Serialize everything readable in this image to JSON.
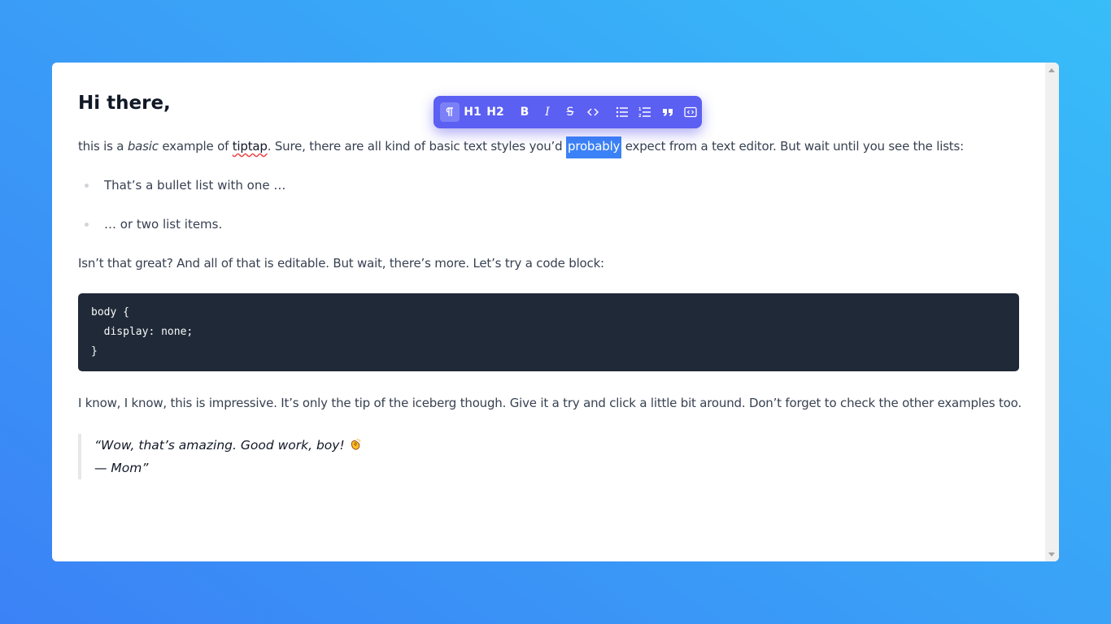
{
  "editor": {
    "heading": "Hi there,",
    "para1": {
      "t1": "this is a ",
      "t2": "basic",
      "t3": " example of ",
      "t4": "tiptap",
      "t5": ". Sure, there are all kind of basic text styles you’d ",
      "selected": "probably",
      "t6": " expect from a text editor. But wait until you see the lists:"
    },
    "bullets": [
      "That’s a bullet list with one …",
      "… or two list items."
    ],
    "para2": "Isn’t that great? And all of that is editable. But wait, there’s more. Let’s try a code block:",
    "code": [
      "body {",
      "  display: none;",
      "}"
    ],
    "para3": "I know, I know, this is impressive. It’s only the tip of the iceberg though. Give it a try and click a little bit around. Don’t forget to check the other examples too.",
    "quote": {
      "line1": "“Wow, that’s amazing. Good work, boy!",
      "line2": "— Mom”",
      "icon": "clapping-hands-icon"
    }
  },
  "toolbar": {
    "paragraph_icon": "pilcrow-icon",
    "h1_label": "H1",
    "h2_label": "H2",
    "bold_label": "B",
    "italic_label": "I",
    "strike_label": "S",
    "code_icon": "code-icon",
    "bullet_list_icon": "bullet-list-icon",
    "ordered_list_icon": "ordered-list-icon",
    "blockquote_icon": "quote-icon",
    "codeblock_icon": "code-block-icon",
    "colors": {
      "background": "#5b5ff2",
      "active": "#7c80f7"
    }
  },
  "colors": {
    "background_start": "#38bdf8",
    "background_end": "#3b82f6",
    "selection": "#3b82f6",
    "code_bg": "#1f2937"
  }
}
